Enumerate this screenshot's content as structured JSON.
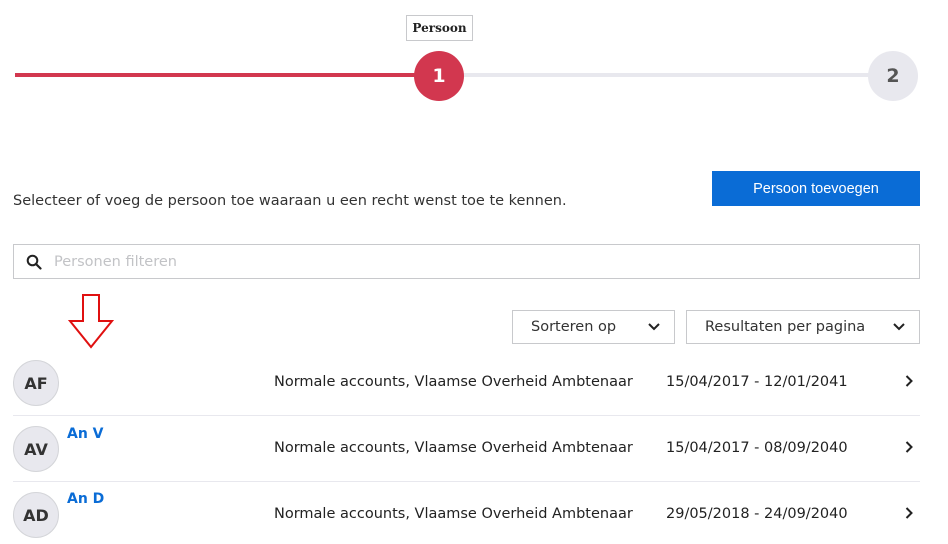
{
  "stepper": {
    "tooltip": "Persoon",
    "steps": [
      {
        "label": "1",
        "state": "active"
      },
      {
        "label": "2",
        "state": "todo"
      }
    ],
    "active_color": "#d2374f",
    "inactive_color": "#e8e8ee"
  },
  "intro_text": "Selecteer of voeg de persoon toe waaraan u een recht wenst toe te kennen.",
  "add_button": {
    "label": "Persoon toevoegen",
    "color": "#0a6cd6"
  },
  "search": {
    "placeholder": "Personen filteren",
    "value": "",
    "icon": "search-icon"
  },
  "sort_dropdown": {
    "label": "Sorteren op",
    "icon": "chevron-down-icon"
  },
  "results_dropdown": {
    "label": "Resultaten per pagina",
    "icon": "chevron-down-icon"
  },
  "rows": [
    {
      "initials": "AF",
      "name": "",
      "account_type": "Normale accounts, Vlaamse Overheid Ambtenaar",
      "period": "15/04/2017 - 12/01/2041"
    },
    {
      "initials": "AV",
      "name": "An V",
      "account_type": "Normale accounts, Vlaamse Overheid Ambtenaar",
      "period": "15/04/2017 - 08/09/2040"
    },
    {
      "initials": "AD",
      "name": "An D",
      "account_type": "Normale accounts, Vlaamse Overheid Ambtenaar",
      "period": "29/05/2018 - 24/09/2040"
    }
  ]
}
